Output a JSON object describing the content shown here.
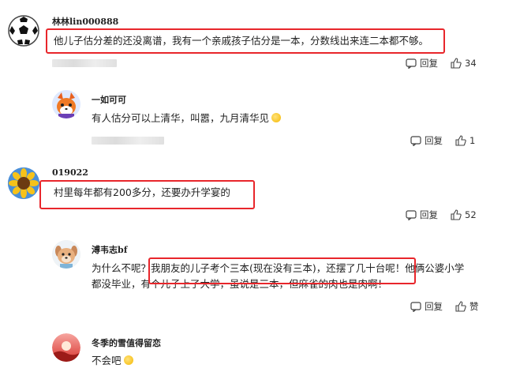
{
  "reply_label": "回复",
  "comments": [
    {
      "username": "林林lin000888",
      "text": "他儿子估分差的还没离谱，我有一个亲戚孩子估分是一本，分数线出来连二本都不够。",
      "likes": "34",
      "avatar": "soccer-ball"
    },
    {
      "username": "一如可可",
      "text": "有人估分可以上清华，叫嚣，九月清华见",
      "likes": "1",
      "avatar": "cartoon-fox"
    },
    {
      "username": "019022",
      "text": "村里每年都有200多分，还要办升学宴的",
      "likes": "52",
      "avatar": "sunflower"
    },
    {
      "username": "溥韦志bf",
      "text_line1_a": "为什么不呢？",
      "text_line1_b": "我朋友的儿子考个三本(现在没有三本)，还摆了几十台呢！",
      "text_line1_c": "他俩公婆小学",
      "text_line2": "都没毕业，有个儿子上了大学，虽说是三本，但麻雀的肉也是肉啊！",
      "likes": "赞",
      "avatar": "cartoon-dog"
    },
    {
      "username": "冬季的雪值得留恋",
      "text": "不会吧",
      "avatar": "red-sunset"
    }
  ]
}
